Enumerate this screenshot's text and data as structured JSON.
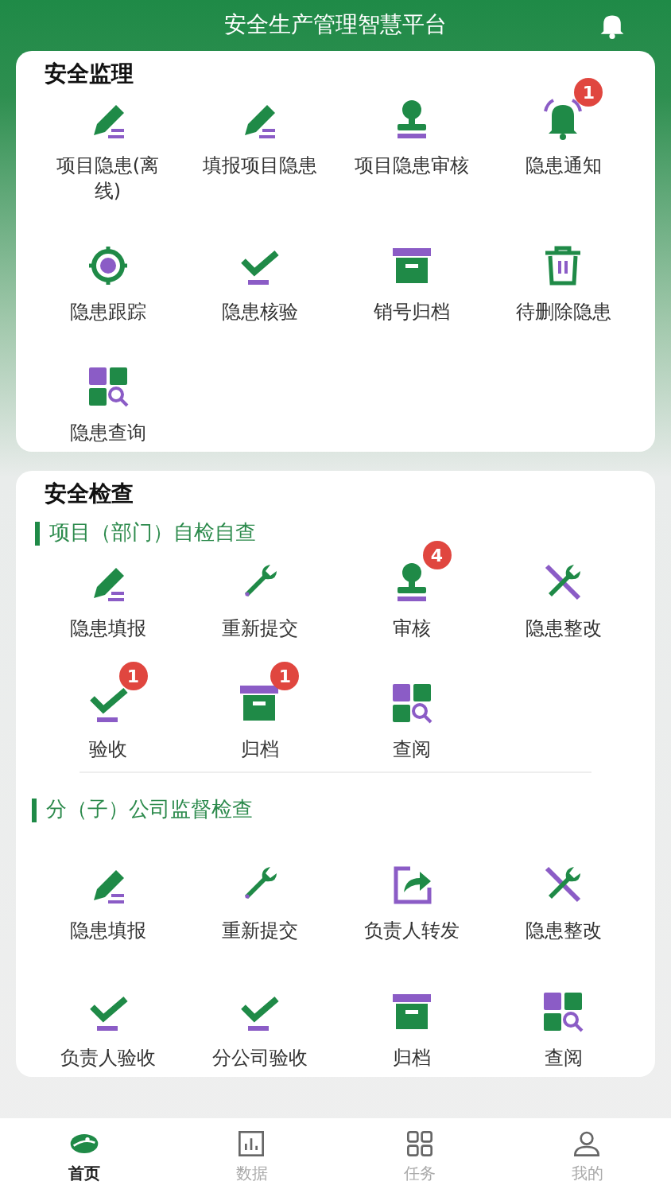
{
  "header": {
    "title": "安全生产管理智慧平台"
  },
  "sections": [
    {
      "title": "安全监理",
      "groups": [
        {
          "items": [
            {
              "label": "项目隐患(离线)",
              "kind": "pencil"
            },
            {
              "label": "填报项目隐患",
              "kind": "pencil"
            },
            {
              "label": "项目隐患审核",
              "kind": "stamp"
            },
            {
              "label": "隐患通知",
              "kind": "bell",
              "badge": "1"
            },
            {
              "label": "隐患跟踪",
              "kind": "target"
            },
            {
              "label": "隐患核验",
              "kind": "check"
            },
            {
              "label": "销号归档",
              "kind": "box"
            },
            {
              "label": "待删除隐患",
              "kind": "trash"
            },
            {
              "label": "隐患查询",
              "kind": "grid"
            }
          ]
        }
      ]
    },
    {
      "title": "安全检查",
      "groups": [
        {
          "title": "项目（部门）自检自查",
          "items": [
            {
              "label": "隐患填报",
              "kind": "pencil"
            },
            {
              "label": "重新提交",
              "kind": "wrench"
            },
            {
              "label": "审核",
              "kind": "stamp",
              "badge": "4"
            },
            {
              "label": "隐患整改",
              "kind": "tools"
            },
            {
              "label": "验收",
              "kind": "check",
              "badge": "1"
            },
            {
              "label": "归档",
              "kind": "box",
              "badge": "1"
            },
            {
              "label": "查阅",
              "kind": "grid"
            }
          ]
        },
        {
          "title": "分（子）公司监督检查",
          "items": [
            {
              "label": "隐患填报",
              "kind": "pencil"
            },
            {
              "label": "重新提交",
              "kind": "wrench"
            },
            {
              "label": "负责人转发",
              "kind": "share"
            },
            {
              "label": "隐患整改",
              "kind": "tools"
            },
            {
              "label": "负责人验收",
              "kind": "check"
            },
            {
              "label": "分公司验收",
              "kind": "check"
            },
            {
              "label": "归档",
              "kind": "box"
            },
            {
              "label": "查阅",
              "kind": "grid"
            }
          ]
        }
      ]
    }
  ],
  "tabs": [
    {
      "label": "首页",
      "kind": "logo",
      "selected": true
    },
    {
      "label": "数据",
      "kind": "chart",
      "selected": false
    },
    {
      "label": "任务",
      "kind": "apps",
      "selected": false
    },
    {
      "label": "我的",
      "kind": "user",
      "selected": false
    }
  ]
}
